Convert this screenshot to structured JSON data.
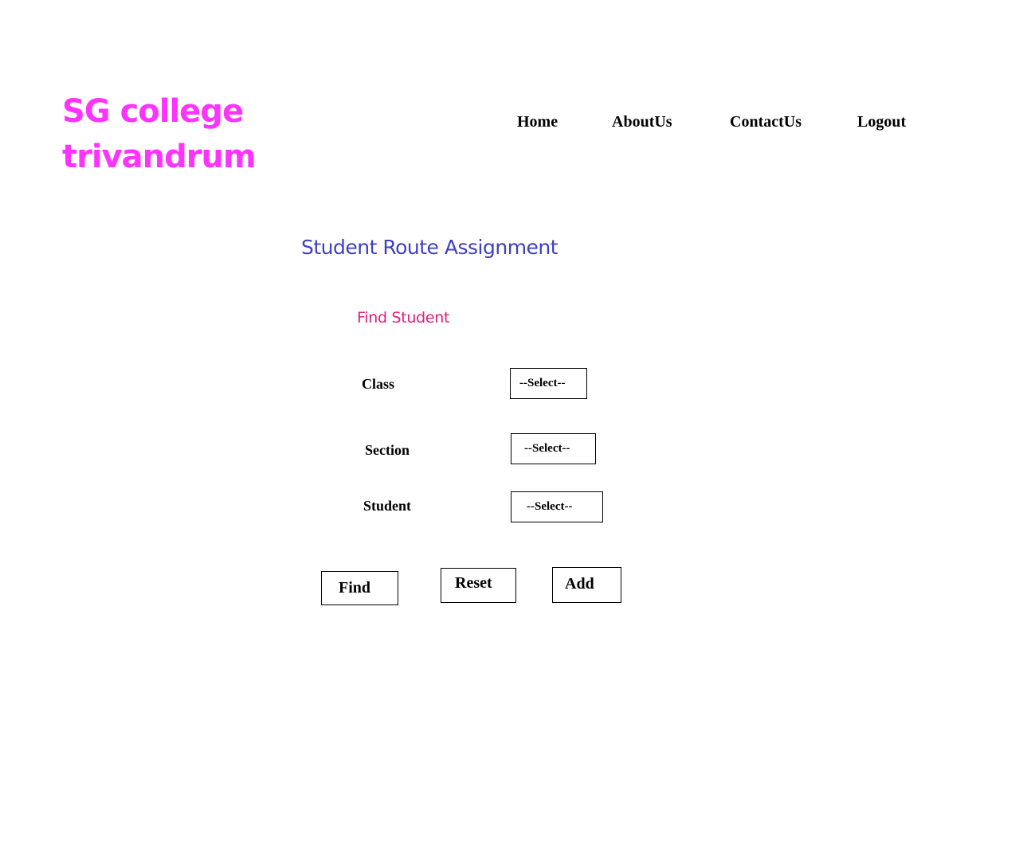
{
  "header": {
    "logo_line1": "SG college",
    "logo_line2": "trivandrum",
    "nav": [
      "Home",
      "AboutUs",
      "ContactUs",
      "Logout"
    ]
  },
  "main": {
    "title": "Student Route Assignment",
    "section_title": "Find Student",
    "fields": [
      {
        "label": "Class",
        "value": "--Select--"
      },
      {
        "label": "Section",
        "value": "--Select--"
      },
      {
        "label": "Student",
        "value": "--Select--"
      }
    ],
    "buttons": {
      "find": "Find",
      "reset": "Reset",
      "add": "Add"
    }
  },
  "colors": {
    "logo": "#ff33ff",
    "title": "#4040c0",
    "section_title": "#e0207a"
  }
}
